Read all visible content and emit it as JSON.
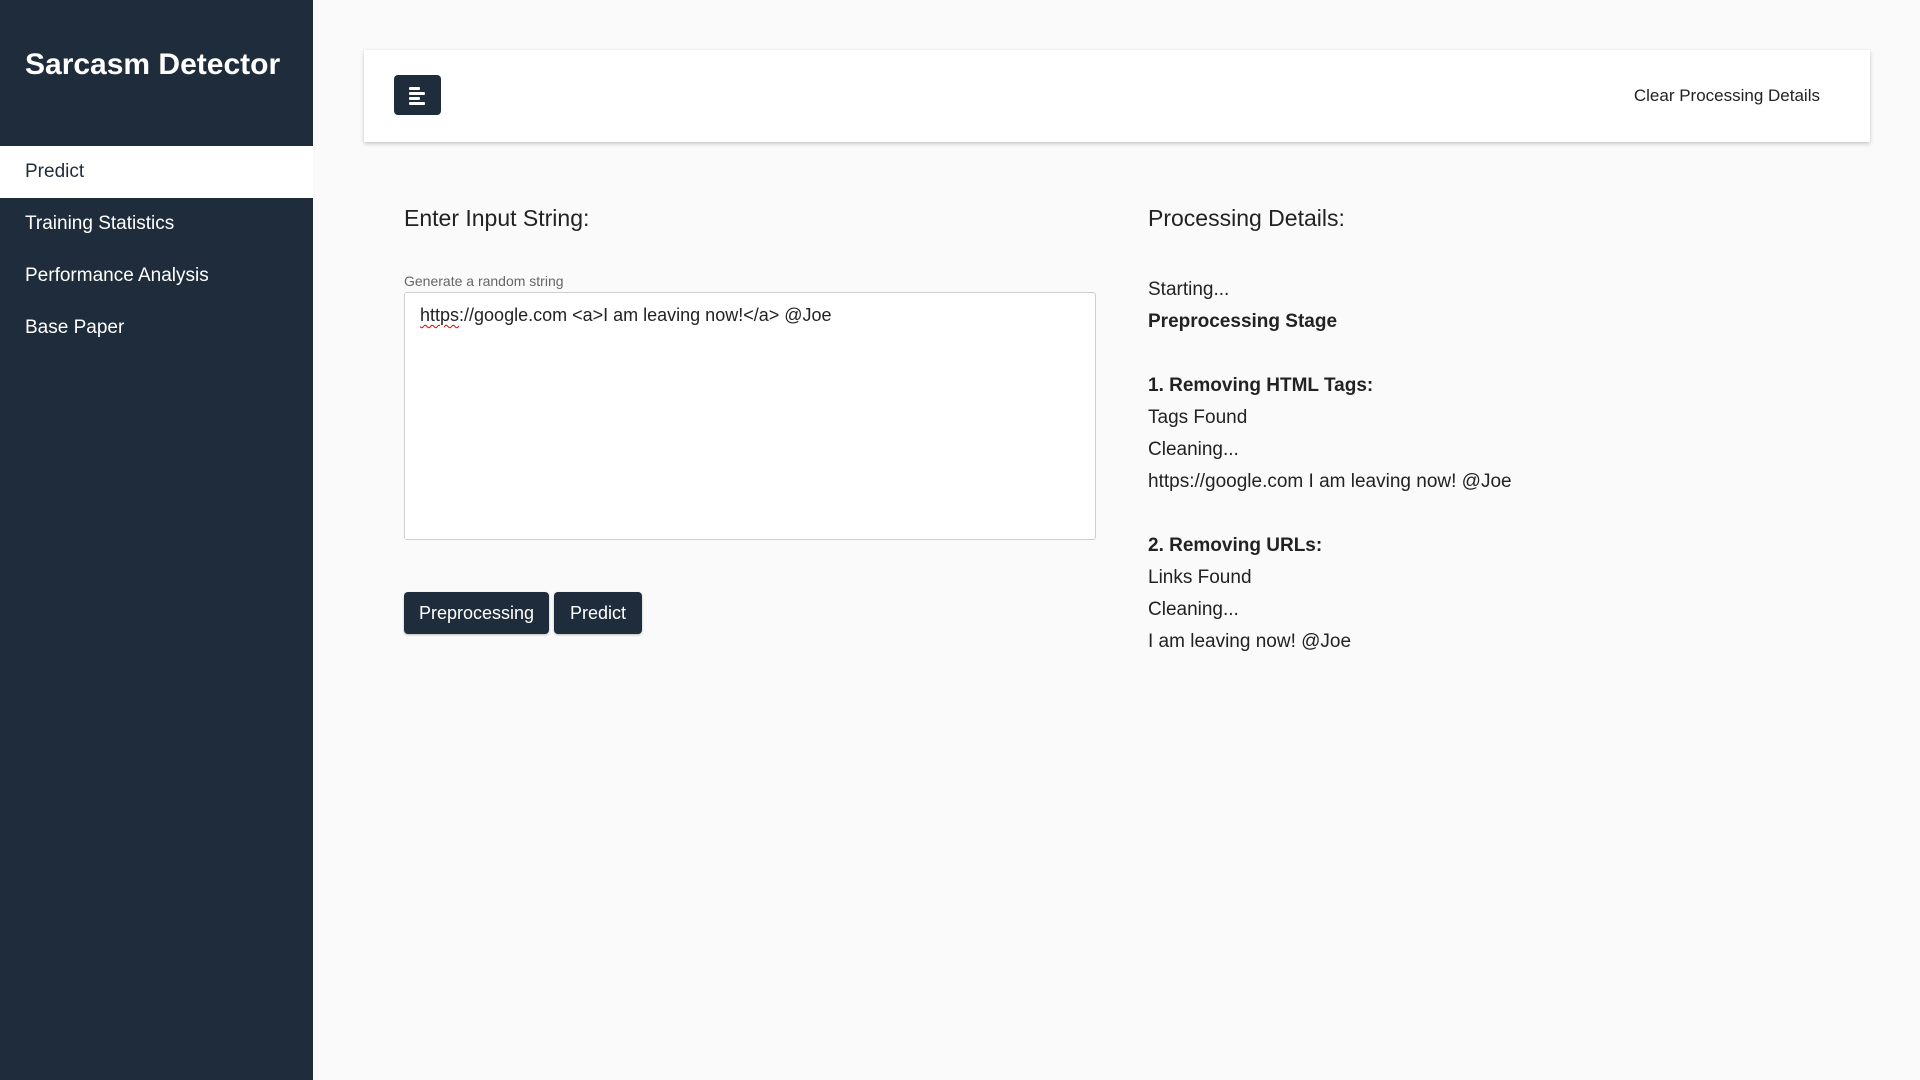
{
  "sidebar": {
    "brand": "Sarcasm Detector",
    "items": [
      {
        "label": "Predict",
        "active": true
      },
      {
        "label": "Training Statistics",
        "active": false
      },
      {
        "label": "Performance Analysis",
        "active": false
      },
      {
        "label": "Base Paper",
        "active": false
      }
    ]
  },
  "topbar": {
    "menu_icon": "align-left-icon",
    "clear_label": "Clear Processing Details"
  },
  "input": {
    "title": "Enter Input String:",
    "helper": "Generate a random string",
    "value_prefix": "https",
    "value_rest": "://google.com <a>I am leaving now!</a> @Joe"
  },
  "buttons": {
    "preprocessing": "Preprocessing",
    "predict": "Predict"
  },
  "details": {
    "title": "Processing Details:",
    "starting": "Starting...",
    "stage": "Preprocessing Stage",
    "step1": {
      "title": "1. Removing HTML Tags:",
      "found": "Tags Found",
      "cleaning": "Cleaning...",
      "result": "https://google.com I am leaving now! @Joe"
    },
    "step2": {
      "title": "2. Removing URLs:",
      "found": "Links Found",
      "cleaning": "Cleaning...",
      "result": "I am leaving now! @Joe"
    }
  },
  "colors": {
    "sidebar_bg": "#1f2c3b",
    "page_bg": "#fafafa",
    "accent": "#1f2c3b"
  }
}
